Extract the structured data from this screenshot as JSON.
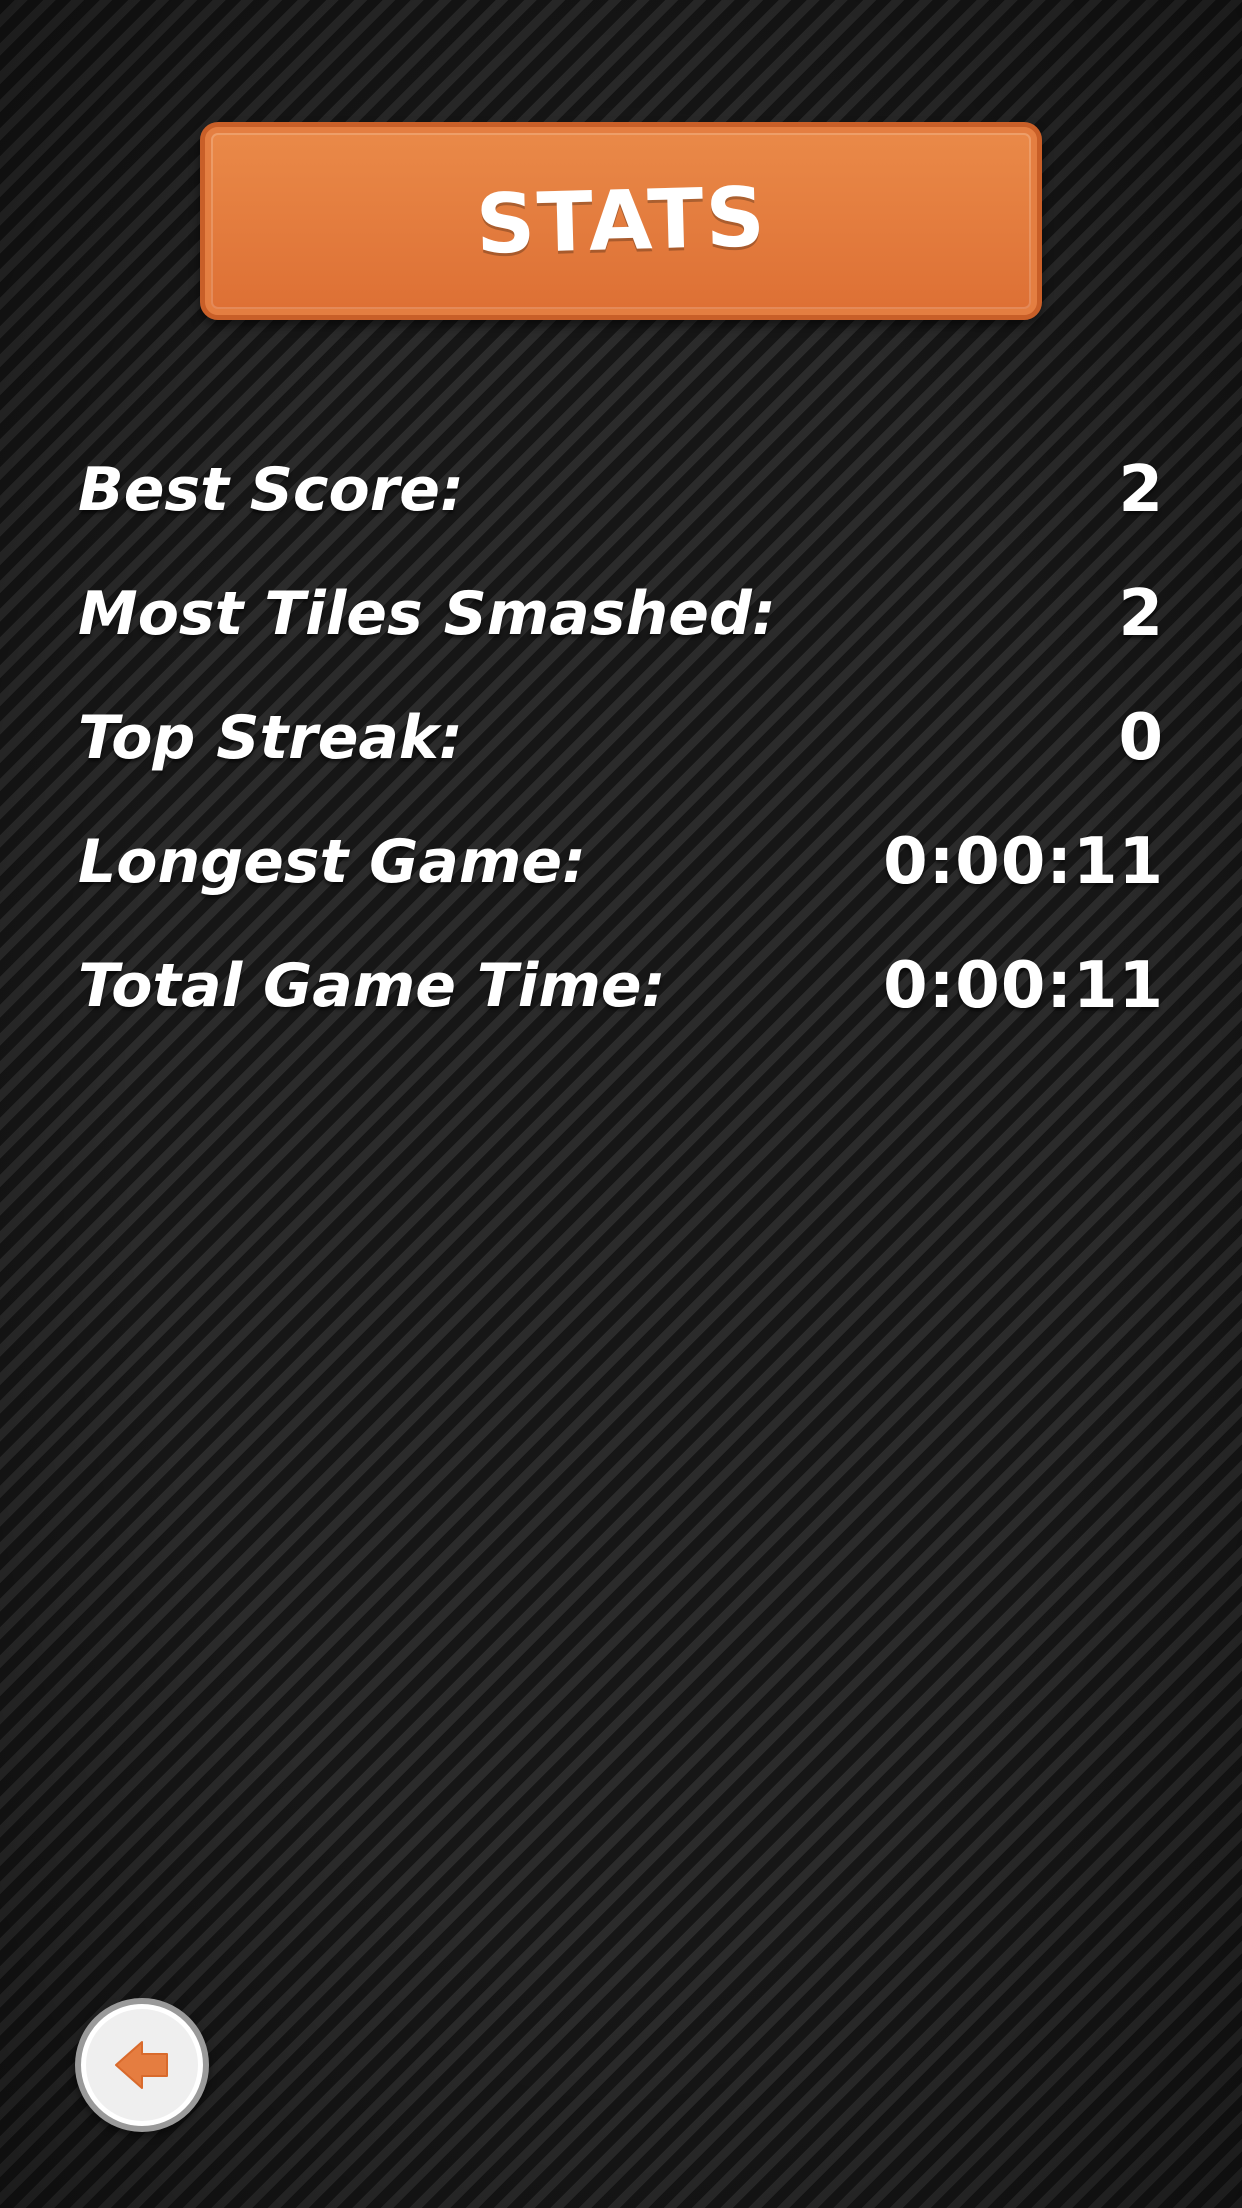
{
  "header": {
    "title": "STATS"
  },
  "stats": [
    {
      "label": "Best Score:",
      "value": "2"
    },
    {
      "label": "Most Tiles Smashed:",
      "value": "2"
    },
    {
      "label": "Top Streak:",
      "value": "0"
    },
    {
      "label": "Longest Game:",
      "value": "0:00:11"
    },
    {
      "label": "Total Game Time:",
      "value": "0:00:11"
    }
  ],
  "back_button": {
    "icon": "arrow-left-icon"
  },
  "colors": {
    "accent": "#e57d40",
    "background": "#1f1f1f",
    "text": "#ffffff",
    "button_face": "#efefef"
  }
}
